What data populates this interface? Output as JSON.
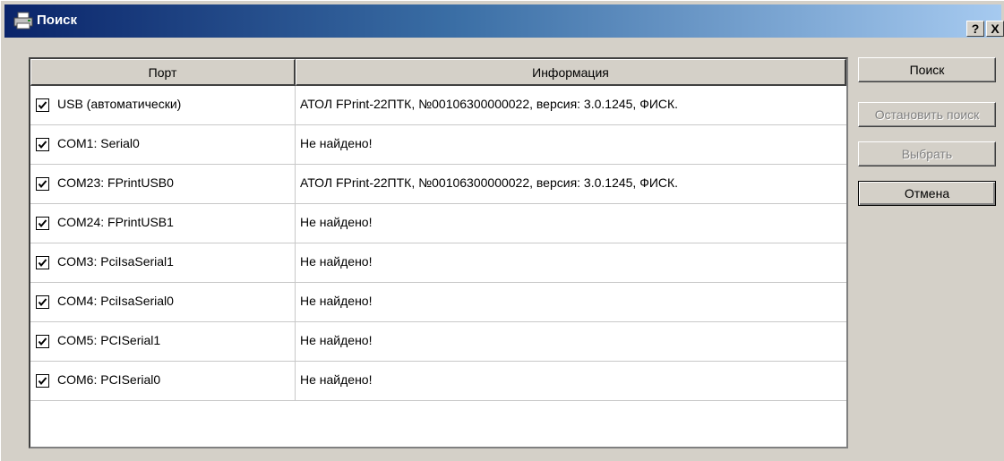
{
  "window": {
    "title": "Поиск",
    "help_label": "?",
    "close_label": "X"
  },
  "grid": {
    "columns": {
      "port": "Порт",
      "info": "Информация"
    },
    "rows": [
      {
        "port": "USB (автоматически)",
        "info": "АТОЛ FPrint-22ПТК, №00106300000022, версия: 3.0.1245, ФИСК.",
        "checked": true
      },
      {
        "port": "COM1: Serial0",
        "info": "Не найдено!",
        "checked": true
      },
      {
        "port": "COM23: FPrintUSB0",
        "info": "АТОЛ FPrint-22ПТК, №00106300000022, версия: 3.0.1245, ФИСК.",
        "checked": true
      },
      {
        "port": "COM24: FPrintUSB1",
        "info": "Не найдено!",
        "checked": true
      },
      {
        "port": "COM3: PciIsaSerial1",
        "info": "Не найдено!",
        "checked": true
      },
      {
        "port": "COM4: PciIsaSerial0",
        "info": "Не найдено!",
        "checked": true
      },
      {
        "port": "COM5: PCISerial1",
        "info": "Не найдено!",
        "checked": true
      },
      {
        "port": "COM6: PCISerial0",
        "info": "Не найдено!",
        "checked": true
      }
    ]
  },
  "buttons": {
    "search": "Поиск",
    "stop_search": "Остановить поиск",
    "select": "Выбрать",
    "cancel": "Отмена"
  },
  "colors": {
    "face": "#d4d0c8",
    "title_start": "#0a246a",
    "title_end": "#a6caf0",
    "disabled_text": "#808080"
  }
}
